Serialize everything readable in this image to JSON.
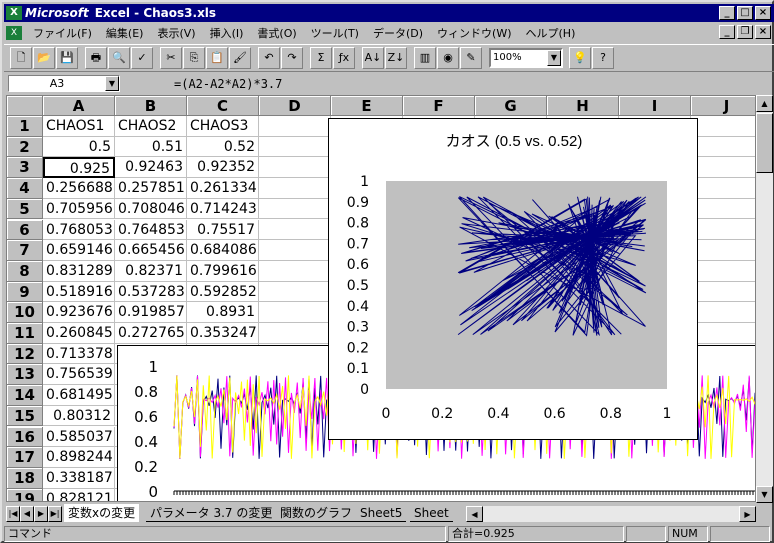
{
  "window": {
    "brand": "Microsoft",
    "title": "Excel - Chaos3.xls"
  },
  "menu": [
    "ファイル(F)",
    "編集(E)",
    "表示(V)",
    "挿入(I)",
    "書式(O)",
    "ツール(T)",
    "データ(D)",
    "ウィンドウ(W)",
    "ヘルプ(H)"
  ],
  "toolbar": {
    "zoom": "100%"
  },
  "formula_bar": {
    "cell_ref": "A3",
    "formula": "=(A2-A2*A2)*3.7"
  },
  "grid": {
    "columns": [
      "A",
      "B",
      "C",
      "D",
      "E",
      "F",
      "G",
      "H",
      "I",
      "J"
    ],
    "rows": [
      "1",
      "2",
      "3",
      "4",
      "5",
      "6",
      "7",
      "8",
      "9",
      "10",
      "11",
      "12",
      "13",
      "14",
      "15",
      "16",
      "17",
      "18",
      "19"
    ],
    "cells": [
      [
        "CHAOS1",
        "CHAOS2",
        "CHAOS3"
      ],
      [
        "0.5",
        "0.51",
        "0.52"
      ],
      [
        "0.925",
        "0.92463",
        "0.92352"
      ],
      [
        "0.256688",
        "0.257851",
        "0.261334"
      ],
      [
        "0.705956",
        "0.708046",
        "0.714243"
      ],
      [
        "0.768053",
        "0.764853",
        "0.75517"
      ],
      [
        "0.659146",
        "0.665456",
        "0.684086"
      ],
      [
        "0.831289",
        "0.82371",
        "0.799616"
      ],
      [
        "0.518916",
        "0.537283",
        "0.592852"
      ],
      [
        "0.923676",
        "0.919857",
        "0.8931"
      ],
      [
        "0.260845",
        "0.272765",
        "0.353247"
      ],
      [
        "0.713378"
      ],
      [
        "0.756539"
      ],
      [
        "0.681495"
      ],
      [
        "0.80312"
      ],
      [
        "0.585037"
      ],
      [
        "0.898244"
      ],
      [
        "0.338187"
      ],
      [
        "0.828121"
      ]
    ]
  },
  "sheet_tabs": [
    "変数xの変更",
    "パラメータ 3.7 の変更",
    "関数のグラフ",
    "Sheet5",
    "Sheet"
  ],
  "status": {
    "mode": "コマンド",
    "sum": "合計=0.925",
    "num": "NUM"
  },
  "chart_data": [
    {
      "type": "line",
      "title": "カオス (0.5 vs. 0.52)",
      "xlim": [
        0,
        1
      ],
      "ylim": [
        0,
        1
      ],
      "x_ticks": [
        "0",
        "0.2",
        "0.4",
        "0.6",
        "0.8",
        "1"
      ],
      "y_ticks": [
        "0",
        "0.1",
        "0.2",
        "0.3",
        "0.4",
        "0.5",
        "0.6",
        "0.7",
        "0.8",
        "0.9",
        "1"
      ],
      "series": [
        {
          "x0": 0.5,
          "y0": 0.52,
          "r": 3.7
        }
      ],
      "colors": {
        "line": "#000080",
        "plot_bg": "#c0c0c0"
      },
      "grid": false
    },
    {
      "type": "line",
      "ylim": [
        0,
        1
      ],
      "y_ticks": [
        "0",
        "0.2",
        "0.4",
        "0.6",
        "0.8",
        "1"
      ],
      "series": [
        {
          "x0": 0.5,
          "r": 3.7,
          "color": "#000080"
        },
        {
          "x0": 0.51,
          "r": 3.7,
          "color": "#ff00ff"
        },
        {
          "x0": 0.52,
          "r": 3.7,
          "color": "#ffff00"
        }
      ],
      "grid": false
    }
  ]
}
